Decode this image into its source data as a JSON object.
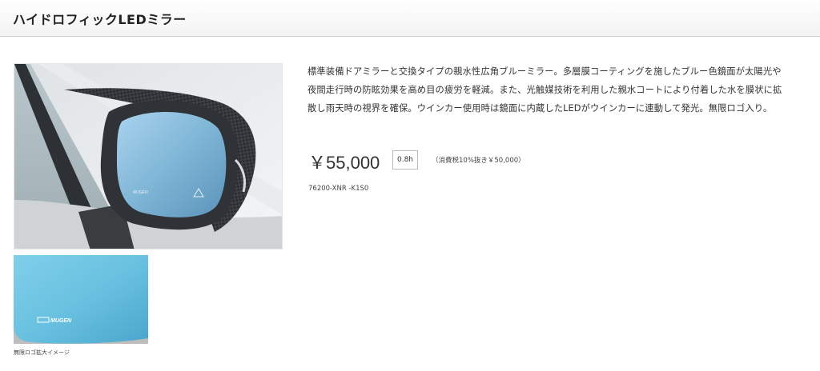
{
  "header": {
    "title": "ハイドロフィックLEDミラー"
  },
  "product": {
    "description": "標準装備ドアミラーと交換タイプの親水性広角ブルーミラー。多層膜コーティングを施したブルー色鏡面が太陽光や夜間走行時の防眩効果を高め目の疲労を軽減。また、光触媒技術を利用した親水コートにより付着した水を膜状に拡散し雨天時の視界を確保。ウインカー使用時は鏡面に内蔵したLEDがウインカーに連動して発光。無限ロゴ入り。",
    "price": "￥55,000",
    "hours": "0.8h",
    "tax_note": "（消費税10%抜き￥50,000）",
    "part_number": "76200-XNR -K1S0"
  },
  "images": {
    "thumb_caption": "無限ロゴ拡大イメージ",
    "logo_text": "MUGEN"
  },
  "colors": {
    "mirror_blue": "#7fb6d6",
    "carbon": "#2b2d31",
    "header_border": "#d0d0d0"
  }
}
